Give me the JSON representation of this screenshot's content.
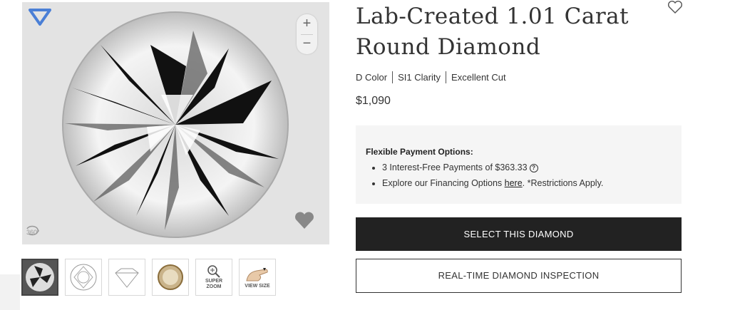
{
  "product": {
    "title": "Lab-Created 1.01 Carat Round Diamond",
    "specs": [
      "D Color",
      "SI1 Clarity",
      "Excellent Cut"
    ],
    "price": "$1,090"
  },
  "viewer": {
    "zoom_in": "+",
    "zoom_out": "−",
    "label_360": "360°"
  },
  "thumbnails": [
    {
      "name": "photo",
      "label": ""
    },
    {
      "name": "facet-diagram",
      "label": ""
    },
    {
      "name": "proportions-diagram",
      "label": ""
    },
    {
      "name": "certificate",
      "label": ""
    },
    {
      "name": "super-zoom",
      "label": "SUPER\nZOOM"
    },
    {
      "name": "view-size",
      "label": "VIEW SIZE"
    }
  ],
  "payment": {
    "heading": "Flexible Payment Options:",
    "item1": "3 Interest-Free Payments of $363.33",
    "item2_prefix": "Explore our Financing Options ",
    "item2_link": "here",
    "item2_suffix": ". *Restrictions Apply."
  },
  "buttons": {
    "select": "SELECT THIS DIAMOND",
    "inspection": "REAL-TIME DIAMOND INSPECTION"
  },
  "colors": {
    "accent": "#4a7fd6",
    "primary_button": "#222222",
    "panel_bg": "#f5f5f5"
  },
  "icons": [
    "brand-diamond-icon",
    "plus-icon",
    "minus-icon",
    "rotate-360-icon",
    "heart-icon",
    "question-icon",
    "magnifier-icon"
  ]
}
